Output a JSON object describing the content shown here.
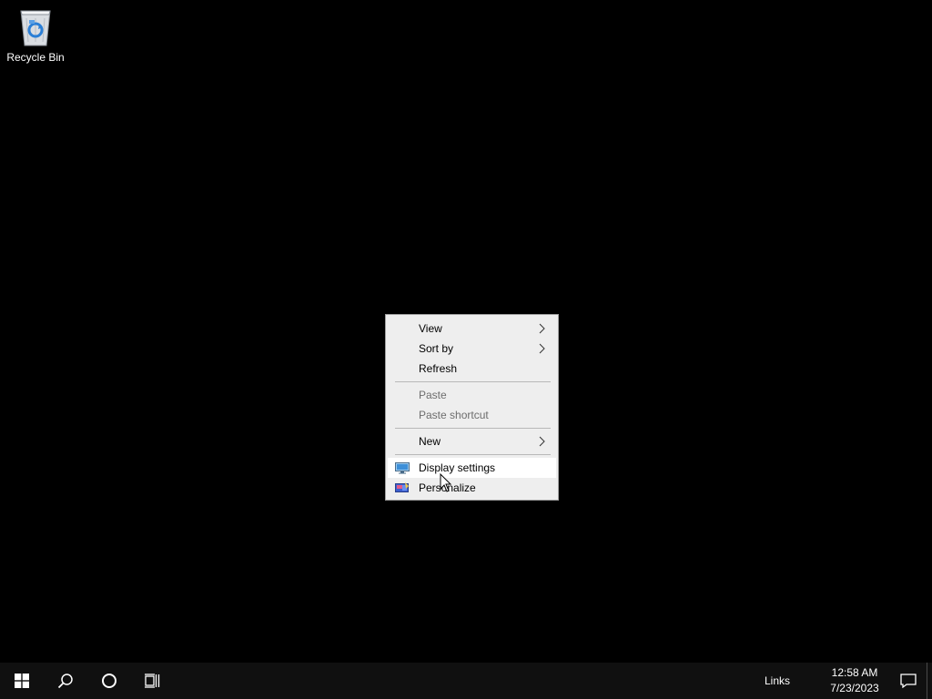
{
  "desktop": {
    "icons": [
      {
        "label": "Recycle Bin",
        "icon": "recycle-bin-icon"
      }
    ]
  },
  "context_menu": {
    "items": [
      {
        "label": "View",
        "submenu": true,
        "enabled": true
      },
      {
        "label": "Sort by",
        "submenu": true,
        "enabled": true
      },
      {
        "label": "Refresh",
        "submenu": false,
        "enabled": true
      },
      {
        "label": "Paste",
        "submenu": false,
        "enabled": false
      },
      {
        "label": "Paste shortcut",
        "submenu": false,
        "enabled": false
      },
      {
        "label": "New",
        "submenu": true,
        "enabled": true
      },
      {
        "label": "Display settings",
        "submenu": false,
        "enabled": true,
        "icon": "display-icon",
        "highlighted": true
      },
      {
        "label": "Personalize",
        "submenu": false,
        "enabled": true,
        "icon": "personalize-icon"
      }
    ]
  },
  "taskbar": {
    "start_icon": "windows-logo-icon",
    "search_icon": "search-icon",
    "cortana_icon": "cortana-circle-icon",
    "task_view_icon": "task-view-icon",
    "toolbar_label": "Links",
    "clock": {
      "time": "12:58 AM",
      "date": "7/23/2023"
    },
    "notification_icon": "action-center-icon"
  },
  "colors": {
    "desktop_bg": "#000000",
    "taskbar_bg": "#101010",
    "menu_bg": "#eeeeee",
    "menu_highlight": "#ffffff",
    "menu_disabled_text": "#6d6d6d"
  }
}
